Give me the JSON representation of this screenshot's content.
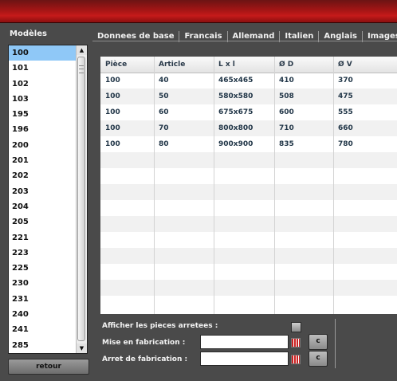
{
  "sidebar": {
    "title": "Modèles",
    "items": [
      "100",
      "101",
      "102",
      "103",
      "195",
      "196",
      "200",
      "201",
      "202",
      "203",
      "204",
      "205",
      "221",
      "223",
      "225",
      "230",
      "231",
      "240",
      "241",
      "285"
    ],
    "selected": "100",
    "retour_label": "retour"
  },
  "tabs": [
    "Donnees de base",
    "Francais",
    "Allemand",
    "Italien",
    "Anglais",
    "Images"
  ],
  "table": {
    "columns": [
      "Pièce",
      "Article",
      "L x l",
      "Ø D",
      "Ø V"
    ],
    "rows": [
      [
        "100",
        "40",
        "465x465",
        "410",
        "370"
      ],
      [
        "100",
        "50",
        "580x580",
        "508",
        "475"
      ],
      [
        "100",
        "60",
        "675x675",
        "600",
        "555"
      ],
      [
        "100",
        "70",
        "800x800",
        "710",
        "660"
      ],
      [
        "100",
        "80",
        "900x900",
        "835",
        "780"
      ]
    ]
  },
  "controls": {
    "afficher_label": "Afficher les pieces arretees  :",
    "mise_label": "Mise en fabrication :",
    "arret_label": "Arret de fabrication :",
    "mise_value": "",
    "arret_value": "",
    "c_button_label": "c"
  },
  "colors": {
    "topbar": "#b01818",
    "selection": "#8fc8f7"
  }
}
